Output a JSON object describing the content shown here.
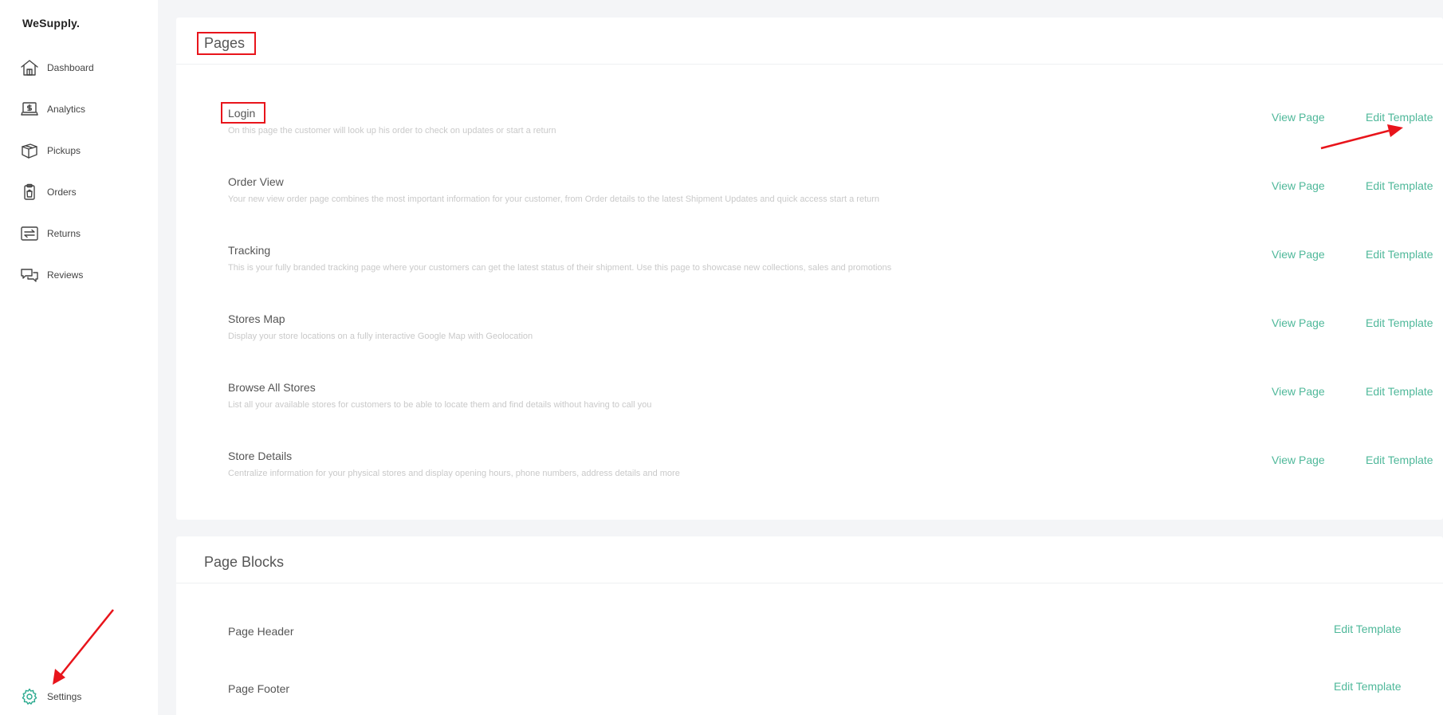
{
  "app": {
    "brand": "WeSupply."
  },
  "sidebar": {
    "items": [
      {
        "label": "Dashboard",
        "icon": "house-icon"
      },
      {
        "label": "Analytics",
        "icon": "laptop-dollar-icon"
      },
      {
        "label": "Pickups",
        "icon": "box-icon"
      },
      {
        "label": "Orders",
        "icon": "clipboard-icon"
      },
      {
        "label": "Returns",
        "icon": "return-arrows-icon"
      },
      {
        "label": "Reviews",
        "icon": "chat-bubbles-icon"
      }
    ],
    "settings": {
      "label": "Settings",
      "icon": "gear-icon"
    }
  },
  "pages": {
    "title": "Pages",
    "view_label": "View Page",
    "edit_label": "Edit Template",
    "rows": [
      {
        "title": "Login",
        "description": "On this page the customer will look up his order to check on updates or start a return"
      },
      {
        "title": "Order View",
        "description": "Your new view order page combines the most important information for your customer, from Order details to the latest Shipment Updates and quick access start a return"
      },
      {
        "title": "Tracking",
        "description": "This is your fully branded tracking page where your customers can get the latest status of their shipment. Use this page to showcase new collections, sales and promotions"
      },
      {
        "title": "Stores Map",
        "description": "Display your store locations on a fully interactive Google Map with Geolocation"
      },
      {
        "title": "Browse All Stores",
        "description": "List all your available stores for customers to be able to locate them and find details without having to call you"
      },
      {
        "title": "Store Details",
        "description": "Centralize information for your physical stores and display opening hours, phone numbers, address details and more"
      }
    ]
  },
  "page_blocks": {
    "title": "Page Blocks",
    "edit_label": "Edit Template",
    "rows": [
      {
        "title": "Page Header"
      },
      {
        "title": "Page Footer"
      }
    ]
  },
  "colors": {
    "accent": "#4fb89a",
    "annotation": "#e8141b",
    "settings_icon": "#29a98e"
  }
}
